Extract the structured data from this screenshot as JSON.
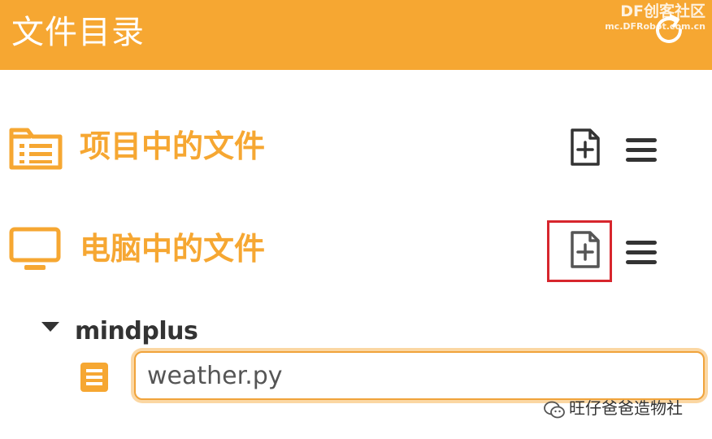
{
  "header": {
    "title": "文件目录",
    "watermark_brand": "DF创客社区",
    "watermark_url": "mc.DFRobot.com.cn",
    "refresh_icon": "refresh-icon",
    "color": "#f6a732"
  },
  "sections": [
    {
      "title": "项目中的文件",
      "icon": "project-folder-icon"
    },
    {
      "title": "电脑中的文件",
      "icon": "computer-monitor-icon"
    }
  ],
  "tree": {
    "folder_name": "mindplus",
    "file_input_value": "weather.py"
  },
  "watermark_bottom": {
    "text": "旺仔爸爸造物社"
  },
  "colors": {
    "accent": "#f6a732",
    "highlight": "#d7262d",
    "icon_dark": "#333333"
  }
}
